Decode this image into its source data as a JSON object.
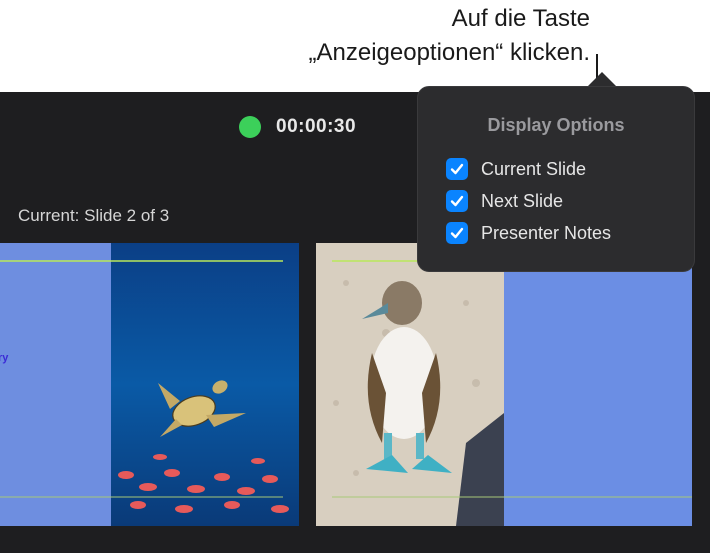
{
  "callout": {
    "line1": "Auf die Taste",
    "line2": "„Anzeigeoptionen“ klicken."
  },
  "toolbar": {
    "timer": "00:00:30",
    "timer_status_color": "#3cd05a",
    "display_options_icon": "display-options-icon",
    "help_icon_glyph": "?"
  },
  "current_slide": {
    "label": "Current: Slide 2 of 3",
    "small_text": "ry"
  },
  "popover": {
    "title": "Display Options",
    "options": [
      {
        "label": "Current Slide",
        "checked": true
      },
      {
        "label": "Next Slide",
        "checked": true
      },
      {
        "label": "Presenter Notes",
        "checked": true
      }
    ]
  },
  "colors": {
    "app_background": "#1e1e20",
    "popover_background": "#2c2c2e",
    "checkbox_accent": "#0a84ff",
    "slide_blue": "#6b8ee4",
    "guide_line_green": "#b9e85a"
  }
}
